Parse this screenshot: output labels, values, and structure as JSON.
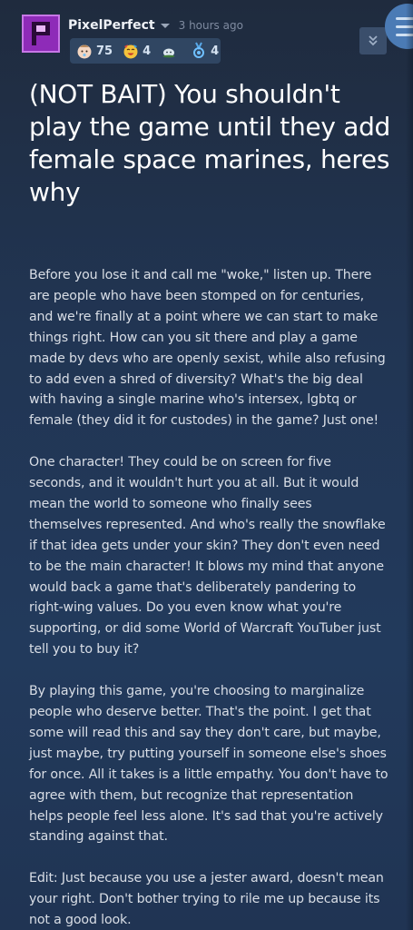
{
  "header": {
    "username": "PixelPerfect",
    "timestamp": "3 hours ago",
    "avatar_icon": "pixel-letter-p-icon",
    "avatar_color": "#8e2bb8",
    "badges": [
      {
        "icon": "baby-face-icon",
        "count": "75"
      },
      {
        "icon": "party-face-icon",
        "count": "4"
      },
      {
        "icon": "blob-icon",
        "count": ""
      },
      {
        "icon": "medal-icon",
        "count": "4"
      }
    ],
    "collapse_icon": "double-chevron-down-icon",
    "menu_icon": "hamburger-menu-icon"
  },
  "post": {
    "title": "(NOT BAIT) You shouldn't play the game until they add female space marines, heres why",
    "paragraphs": [
      "Before you lose it and call me \"woke,\" listen up. There are people who have been stomped on for centuries, and we're finally at a point where we can start to make things right. How can you sit there and play a game made by devs who are openly sexist, while also refusing to add even a shred of diversity? What's the big deal with having a single marine who's intersex, lgbtq or female (they did it for custodes) in the game? Just one!",
      "One character! They could be on screen for five seconds, and it wouldn't hurt you at all. But it would mean the world to someone who finally sees themselves represented. And who's really the snowflake if that idea gets under your skin? They don't even need to be the main character! It blows my mind that anyone would back a game that's deliberately pandering to right-wing values. Do you even know what you're supporting, or did some World of Warcraft YouTuber just tell you to buy it?",
      "By playing this game, you're choosing to marginalize people who deserve better. That's the point. I get that some will read this and say they don't care, but maybe, just maybe, try putting yourself in someone else's shoes for once. All it takes is a little empathy. You don't have to agree with them, but recognize that representation helps people feel less alone. It's sad that you're actively standing against that.",
      "Edit: Just because you use a jester award, doesn't mean your right. Don't bother trying to rile me up because its not a good look."
    ]
  },
  "colors": {
    "background_top": "#1f2b3e",
    "background_bottom": "#223a5c",
    "accent_blue": "#4b7bb5",
    "badge_count": "#d6e3f2"
  }
}
